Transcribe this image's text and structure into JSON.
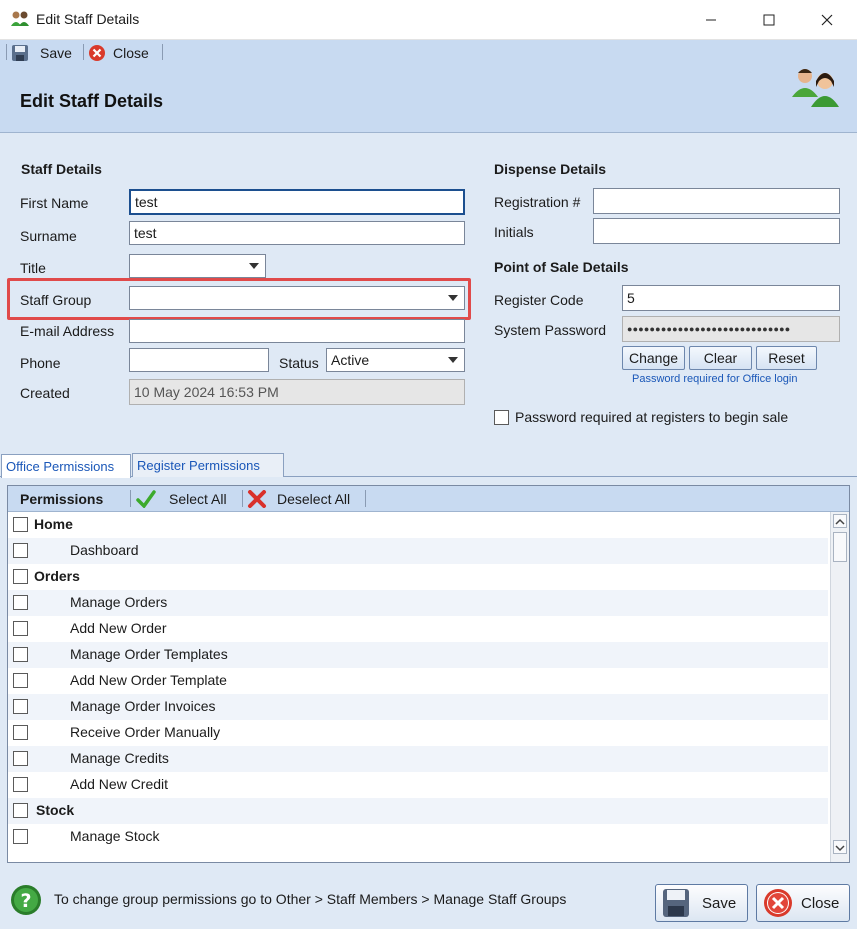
{
  "window": {
    "title": "Edit Staff Details"
  },
  "toolbar": {
    "save_label": "Save",
    "close_label": "Close"
  },
  "header": {
    "title": "Edit Staff Details"
  },
  "staff": {
    "section_title": "Staff Details",
    "first_name_label": "First Name",
    "first_name_value": "test",
    "surname_label": "Surname",
    "surname_value": "test",
    "title_label": "Title",
    "title_value": "",
    "staff_group_label": "Staff Group",
    "staff_group_value": "",
    "email_label": "E-mail Address",
    "email_value": "",
    "phone_label": "Phone",
    "phone_value": "",
    "status_label": "Status",
    "status_value": "Active",
    "created_label": "Created",
    "created_value": "10 May 2024 16:53 PM"
  },
  "dispense": {
    "section_title": "Dispense Details",
    "registration_label": "Registration #",
    "registration_value": "",
    "initials_label": "Initials",
    "initials_value": ""
  },
  "pos": {
    "section_title": "Point of Sale Details",
    "register_code_label": "Register Code",
    "register_code_value": "5",
    "system_password_label": "System Password",
    "system_password_value": "●●●●●●●●●●●●●●●●●●●●●●●●●●●●●",
    "change_label": "Change",
    "clear_label": "Clear",
    "reset_label": "Reset",
    "password_note": "Password required for Office login",
    "register_checkbox_label": "Password required at registers to begin sale",
    "register_checkbox_checked": false
  },
  "tabs": [
    {
      "label": "Office Permissions",
      "active": true
    },
    {
      "label": "Register Permissions",
      "active": false
    }
  ],
  "permissions": {
    "header_label": "Permissions",
    "select_all_label": "Select All",
    "deselect_all_label": "Deselect All",
    "rows": [
      {
        "label": "Home",
        "group": true,
        "checked": false
      },
      {
        "label": "Dashboard",
        "group": false,
        "checked": false
      },
      {
        "label": "Orders",
        "group": true,
        "checked": false
      },
      {
        "label": "Manage Orders",
        "group": false,
        "checked": false
      },
      {
        "label": "Add New Order",
        "group": false,
        "checked": false
      },
      {
        "label": "Manage Order Templates",
        "group": false,
        "checked": false
      },
      {
        "label": "Add New Order Template",
        "group": false,
        "checked": false
      },
      {
        "label": "Manage Order Invoices",
        "group": false,
        "checked": false
      },
      {
        "label": "Receive Order Manually",
        "group": false,
        "checked": false
      },
      {
        "label": "Manage Credits",
        "group": false,
        "checked": false
      },
      {
        "label": "Add New Credit",
        "group": false,
        "checked": false
      },
      {
        "label": "Stock",
        "group": true,
        "checked": false
      },
      {
        "label": "Manage Stock",
        "group": false,
        "checked": false
      }
    ]
  },
  "footer": {
    "hint": "To change group permissions go to Other > Staff Members > Manage Staff Groups",
    "save_label": "Save",
    "close_label": "Close"
  },
  "colors": {
    "highlight": "#e04a4a",
    "header_bg": "#c8daf1",
    "accent": "#1a57b8"
  }
}
